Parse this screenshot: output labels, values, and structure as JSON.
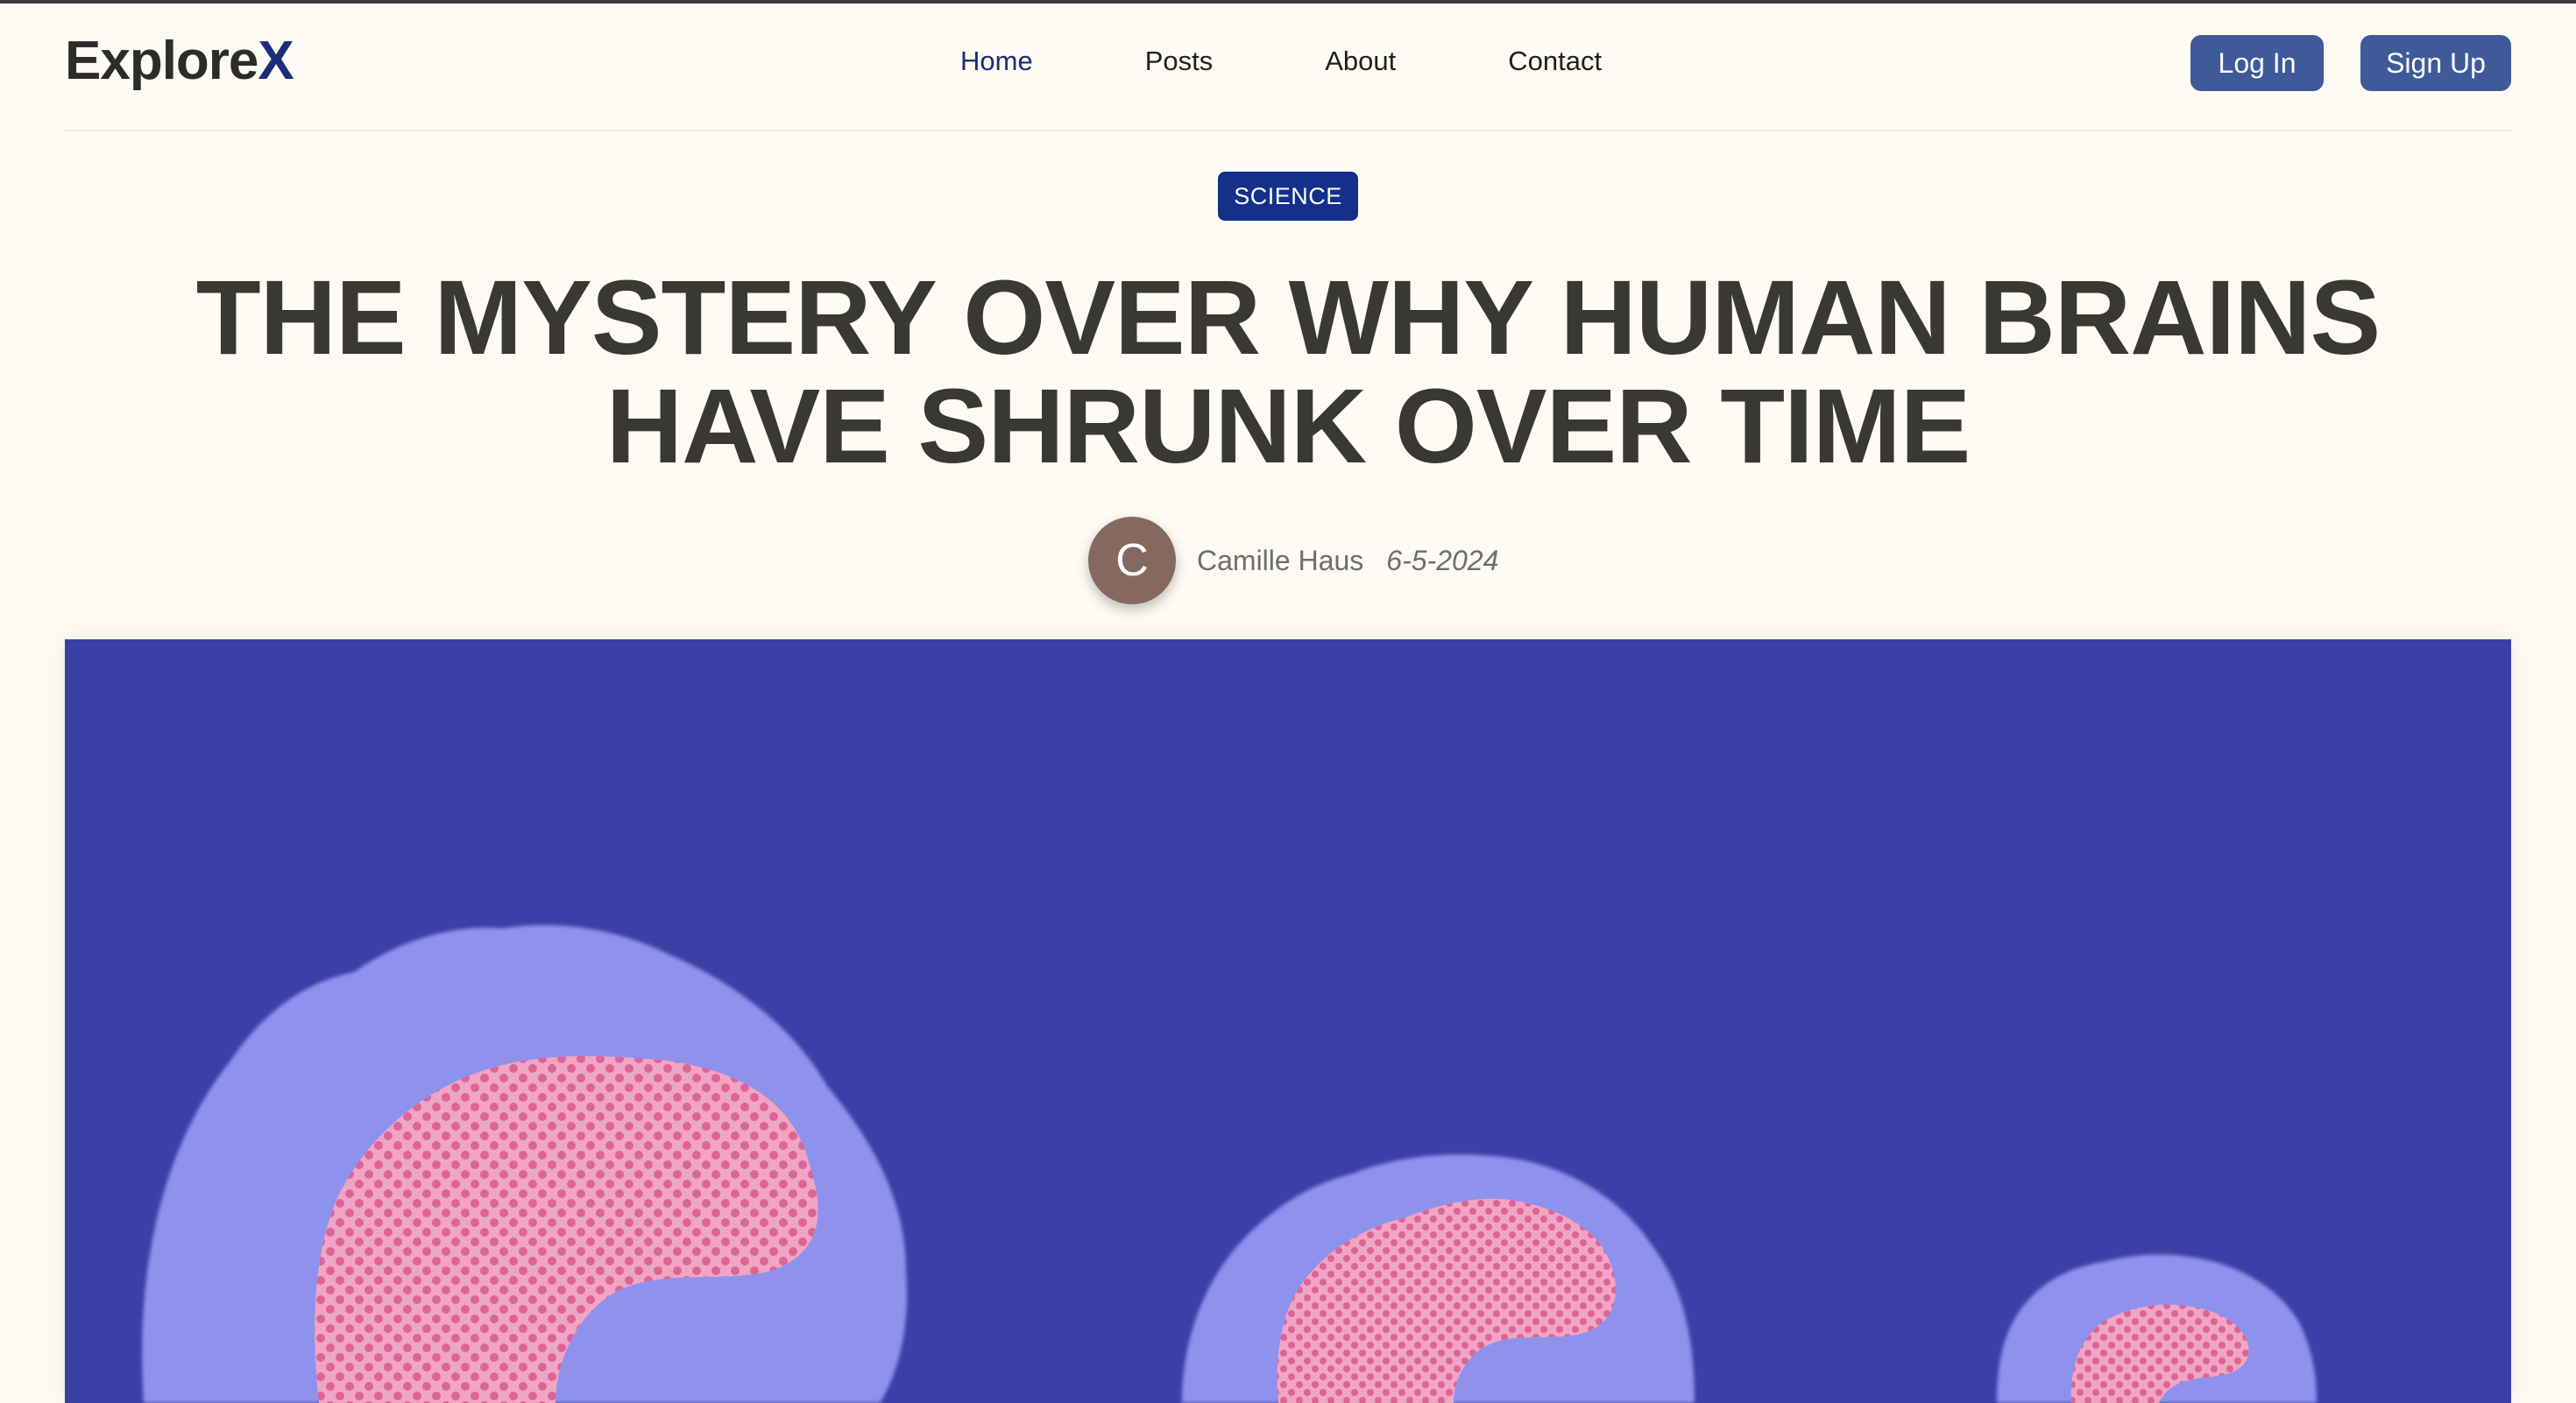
{
  "header": {
    "logo_main": "Explore",
    "logo_accent": "X",
    "nav": [
      {
        "label": "Home",
        "active": true
      },
      {
        "label": "Posts",
        "active": false
      },
      {
        "label": "About",
        "active": false
      },
      {
        "label": "Contact",
        "active": false
      }
    ],
    "login_label": "Log In",
    "signup_label": "Sign Up"
  },
  "article": {
    "category": "SCIENCE",
    "title": "THE MYSTERY OVER WHY HUMAN BRAINS HAVE SHRUNK OVER TIME",
    "author_initial": "C",
    "author": "Camille Haus",
    "date": "6-5-2024"
  },
  "hero_image": {
    "icon": "brain-illustration",
    "colors": {
      "background": "#3a40a6",
      "outer": "#8f92ec",
      "inner": "#f0a5c4",
      "dots": "#dd6497"
    }
  },
  "colors": {
    "brand": "#1b2d7a",
    "button": "#3f5a99",
    "badge": "#14308a",
    "title": "#3a3833",
    "page_bg": "#fdfbf3"
  }
}
